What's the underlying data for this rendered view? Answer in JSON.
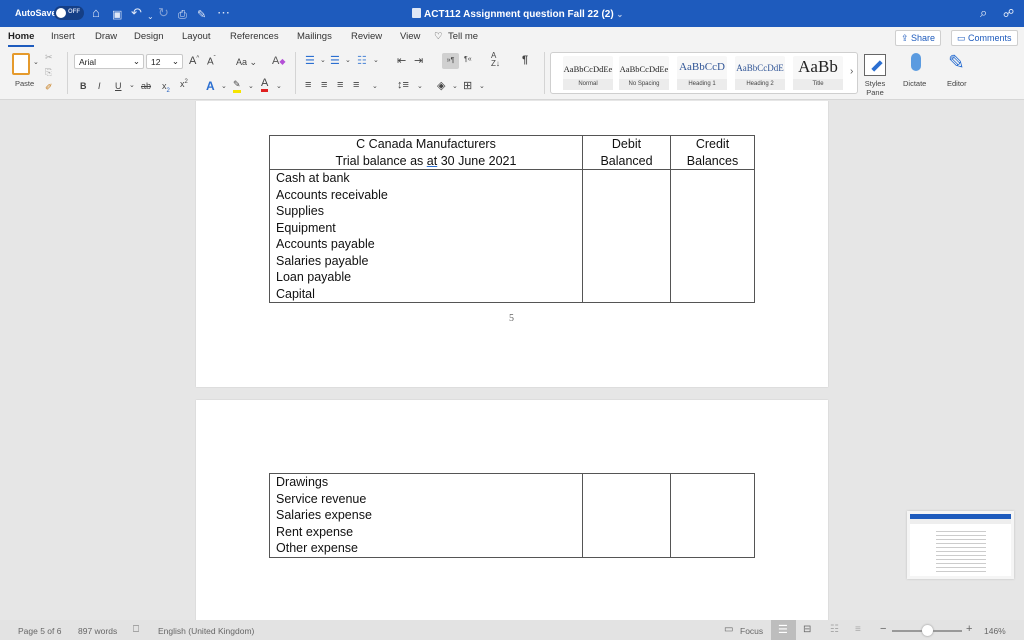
{
  "titlebar": {
    "autosave_label": "AutoSave",
    "autosave_state": "OFF",
    "document_title": "ACT112 Assignment question Fall 22 (2)",
    "quick_access": [
      "home-icon",
      "save-icon",
      "undo-icon",
      "redo-icon",
      "print-icon",
      "edit-icon",
      "more-icon"
    ],
    "right_icons": [
      "search-icon",
      "account-icon"
    ]
  },
  "tabs": [
    {
      "label": "Home",
      "active": true
    },
    {
      "label": "Insert"
    },
    {
      "label": "Draw"
    },
    {
      "label": "Design"
    },
    {
      "label": "Layout"
    },
    {
      "label": "References"
    },
    {
      "label": "Mailings"
    },
    {
      "label": "Review"
    },
    {
      "label": "View"
    },
    {
      "label": "Tell me"
    }
  ],
  "actions": {
    "share": "Share",
    "comments": "Comments"
  },
  "ribbon": {
    "paste_label": "Paste",
    "font_name": "Arial",
    "font_size": "12",
    "change_case": "Aa",
    "styles": [
      {
        "preview": "AaBbCcDdEe",
        "label": "Normal"
      },
      {
        "preview": "AaBbCcDdEe",
        "label": "No Spacing"
      },
      {
        "preview": "AaBbCcD",
        "label": "Heading 1"
      },
      {
        "preview": "AaBbCcDdE",
        "label": "Heading 2"
      },
      {
        "preview": "AaBb",
        "label": "Title"
      }
    ],
    "styles_pane_label": "Styles Pane",
    "dictate_label": "Dictate",
    "editor_label": "Editor",
    "colors": {
      "highlight": "#f5e400",
      "font_color": "#e02020",
      "accent": "#1e5bbd"
    }
  },
  "document": {
    "page5": {
      "header": {
        "title_line1": "C Canada Manufacturers",
        "title_line2_pre": "Trial balance as ",
        "title_line2_at": "at",
        "title_line2_post": " 30 June 2021",
        "debit_line1": "Debit",
        "debit_line2": "Balanced",
        "credit_line1": "Credit",
        "credit_line2": "Balances"
      },
      "accounts": [
        "Cash at bank",
        "Accounts receivable",
        "Supplies",
        "Equipment",
        "Accounts payable",
        "Salaries payable",
        "Loan payable",
        "Capital"
      ],
      "page_number": "5"
    },
    "page6": {
      "accounts": [
        "Drawings",
        "Service revenue",
        "Salaries expense",
        "Rent expense",
        "Other expense"
      ]
    }
  },
  "statusbar": {
    "page": "Page 5 of 6",
    "words": "897 words",
    "language": "English (United Kingdom)",
    "focus": "Focus",
    "zoom_minus": "−",
    "zoom_plus": "+",
    "zoom_level": "146%",
    "zoom_slider_fraction": 0.5
  }
}
